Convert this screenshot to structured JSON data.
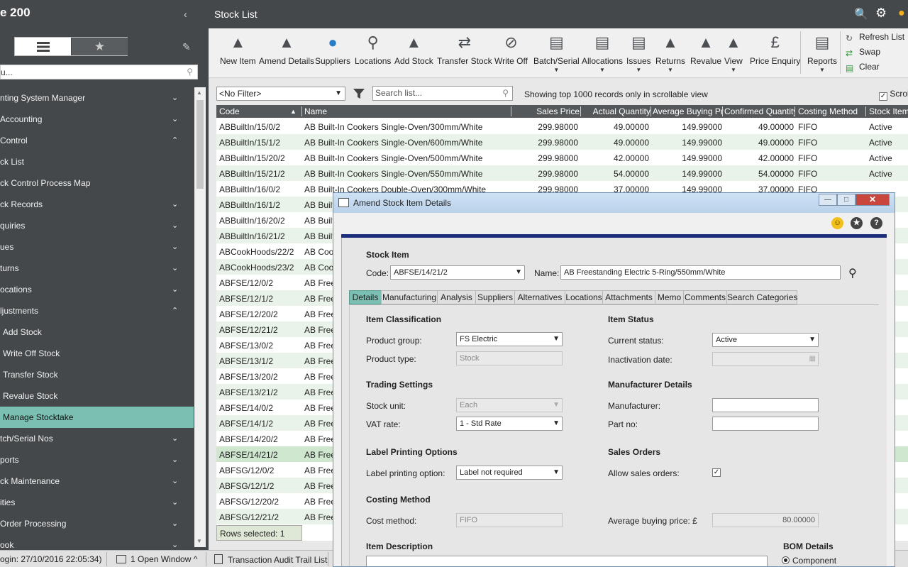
{
  "app": {
    "title": "e 200"
  },
  "sidebar": {
    "search_placeholder": "u...",
    "items": [
      {
        "label": "nting System Manager",
        "chev": "⌄",
        "cls": ""
      },
      {
        "label": "Accounting",
        "chev": "⌄",
        "cls": ""
      },
      {
        "label": "Control",
        "chev": "⌃",
        "cls": ""
      },
      {
        "label": "ck List",
        "chev": "",
        "cls": ""
      },
      {
        "label": "ck Control Process Map",
        "chev": "",
        "cls": ""
      },
      {
        "label": "ck Records",
        "chev": "⌄",
        "cls": ""
      },
      {
        "label": "quiries",
        "chev": "⌄",
        "cls": ""
      },
      {
        "label": "ues",
        "chev": "⌄",
        "cls": ""
      },
      {
        "label": "turns",
        "chev": "⌄",
        "cls": ""
      },
      {
        "label": "ocations",
        "chev": "⌄",
        "cls": ""
      },
      {
        "label": "ljustments",
        "chev": "⌃",
        "cls": ""
      },
      {
        "label": "Add Stock",
        "chev": "",
        "cls": "sub"
      },
      {
        "label": "Write Off Stock",
        "chev": "",
        "cls": "sub"
      },
      {
        "label": "Transfer Stock",
        "chev": "",
        "cls": "sub"
      },
      {
        "label": "Revalue Stock",
        "chev": "",
        "cls": "sub"
      },
      {
        "label": "Manage Stocktake",
        "chev": "",
        "cls": "sub active"
      },
      {
        "label": "tch/Serial Nos",
        "chev": "⌄",
        "cls": ""
      },
      {
        "label": "ports",
        "chev": "⌄",
        "cls": ""
      },
      {
        "label": "ck Maintenance",
        "chev": "⌄",
        "cls": ""
      },
      {
        "label": "ities",
        "chev": "⌄",
        "cls": ""
      },
      {
        "label": "Order Processing",
        "chev": "⌄",
        "cls": ""
      },
      {
        "label": "ook",
        "chev": "⌄",
        "cls": ""
      }
    ]
  },
  "header": {
    "title": "Stock List"
  },
  "toolbar": {
    "buttons": [
      "New Item",
      "Amend Details",
      "Suppliers",
      "Locations",
      "Add Stock",
      "Transfer Stock",
      "Write Off",
      "Batch/Serial",
      "Allocations",
      "Issues",
      "Returns",
      "Revalue",
      "View",
      "Price Enquiry",
      "Reports"
    ],
    "side": [
      "Refresh List",
      "Swap",
      "Clear"
    ]
  },
  "filter": {
    "selected": "<No Filter>",
    "search_placeholder": "Search list...",
    "showing": "Showing top 1000 records only in scrollable view",
    "scroll_label": "Scrol"
  },
  "grid": {
    "columns": [
      "Code",
      "Name",
      "Sales Price",
      "Actual Quantity",
      "Average Buying Pric",
      "Confirmed Quantity I",
      "Costing Method",
      "Stock Item S"
    ],
    "rows": [
      [
        "ABBuiltIn/15/0/2",
        "AB Built-In Cookers Single-Oven/300mm/White",
        "299.98000",
        "49.00000",
        "149.99000",
        "49.00000",
        "FIFO",
        "Active"
      ],
      [
        "ABBuiltIn/15/1/2",
        "AB Built-In Cookers Single-Oven/600mm/White",
        "299.98000",
        "49.00000",
        "149.99000",
        "49.00000",
        "FIFO",
        "Active"
      ],
      [
        "ABBuiltIn/15/20/2",
        "AB Built-In Cookers Single-Oven/500mm/White",
        "299.98000",
        "42.00000",
        "149.99000",
        "42.00000",
        "FIFO",
        "Active"
      ],
      [
        "ABBuiltIn/15/21/2",
        "AB Built-In Cookers Single-Oven/550mm/White",
        "299.98000",
        "54.00000",
        "149.99000",
        "54.00000",
        "FIFO",
        "Active"
      ],
      [
        "ABBuiltIn/16/0/2",
        "AB Built-In Cookers Double-Oven/300mm/White",
        "299.98000",
        "37.00000",
        "149.99000",
        "37.00000",
        "FIFO",
        ""
      ],
      [
        "ABBuiltIn/16/1/2",
        "AB Built",
        "",
        "",
        "",
        "",
        "",
        ""
      ],
      [
        "ABBuiltIn/16/20/2",
        "AB Built",
        "",
        "",
        "",
        "",
        "",
        ""
      ],
      [
        "ABBuiltIn/16/21/2",
        "AB Built",
        "",
        "",
        "",
        "",
        "",
        ""
      ],
      [
        "ABCookHoods/22/2",
        "AB Coo",
        "",
        "",
        "",
        "",
        "",
        ""
      ],
      [
        "ABCookHoods/23/2",
        "AB Coo",
        "",
        "",
        "",
        "",
        "",
        ""
      ],
      [
        "ABFSE/12/0/2",
        "AB Free",
        "",
        "",
        "",
        "",
        "",
        ""
      ],
      [
        "ABFSE/12/1/2",
        "AB Free",
        "",
        "",
        "",
        "",
        "",
        ""
      ],
      [
        "ABFSE/12/20/2",
        "AB Free",
        "",
        "",
        "",
        "",
        "",
        ""
      ],
      [
        "ABFSE/12/21/2",
        "AB Free",
        "",
        "",
        "",
        "",
        "",
        ""
      ],
      [
        "ABFSE/13/0/2",
        "AB Free",
        "",
        "",
        "",
        "",
        "",
        ""
      ],
      [
        "ABFSE/13/1/2",
        "AB Free",
        "",
        "",
        "",
        "",
        "",
        ""
      ],
      [
        "ABFSE/13/20/2",
        "AB Free",
        "",
        "",
        "",
        "",
        "",
        ""
      ],
      [
        "ABFSE/13/21/2",
        "AB Free",
        "",
        "",
        "",
        "",
        "",
        ""
      ],
      [
        "ABFSE/14/0/2",
        "AB Free",
        "",
        "",
        "",
        "",
        "",
        ""
      ],
      [
        "ABFSE/14/1/2",
        "AB Free",
        "",
        "",
        "",
        "",
        "",
        ""
      ],
      [
        "ABFSE/14/20/2",
        "AB Free",
        "",
        "",
        "",
        "",
        "",
        ""
      ],
      [
        "ABFSE/14/21/2",
        "AB Free",
        "",
        "",
        "",
        "",
        "",
        ""
      ],
      [
        "ABFSG/12/0/2",
        "AB Free",
        "",
        "",
        "",
        "",
        "",
        ""
      ],
      [
        "ABFSG/12/1/2",
        "AB Free",
        "",
        "",
        "",
        "",
        "",
        ""
      ],
      [
        "ABFSG/12/20/2",
        "AB Free",
        "",
        "",
        "",
        "",
        "",
        ""
      ],
      [
        "ABFSG/12/21/2",
        "AB Free",
        "",
        "",
        "",
        "",
        "",
        ""
      ]
    ],
    "selected_row": 21,
    "rows_selected": "Rows selected: 1"
  },
  "statusbar": {
    "login": "ogin: 27/10/2016 22:05:34)",
    "open_windows": "1 Open Window ^",
    "audit": "Transaction Audit Trail List"
  },
  "dialog": {
    "title": "Amend Stock Item Details",
    "section_title": "Stock Item",
    "code_label": "Code:",
    "code_value": "ABFSE/14/21/2",
    "name_label": "Name:",
    "name_value": "AB Freestanding Electric 5-Ring/550mm/White",
    "tabs": [
      "Details",
      "Manufacturing",
      "Analysis",
      "Suppliers",
      "Alternatives",
      "Locations",
      "Attachments",
      "Memo",
      "Comments",
      "Search Categories"
    ],
    "item_classification": "Item Classification",
    "product_group_label": "Product group:",
    "product_group": "FS Electric",
    "product_type_label": "Product type:",
    "product_type": "Stock",
    "item_status": "Item Status",
    "current_status_label": "Current status:",
    "current_status": "Active",
    "inactivation_label": "Inactivation date:",
    "trading_settings": "Trading Settings",
    "stock_unit_label": "Stock unit:",
    "stock_unit": "Each",
    "vat_label": "VAT rate:",
    "vat_rate": "1 - Std Rate",
    "manufacturer_details": "Manufacturer Details",
    "manufacturer_label": "Manufacturer:",
    "part_no_label": "Part no:",
    "label_printing": "Label Printing Options",
    "label_option_label": "Label printing option:",
    "label_option": "Label not required",
    "sales_orders": "Sales Orders",
    "allow_sales_label": "Allow sales orders:",
    "costing_method": "Costing Method",
    "cost_method_label": "Cost method:",
    "cost_method": "FIFO",
    "avg_buying_label": "Average buying price: £",
    "avg_buying": "80.00000",
    "item_description": "Item Description",
    "bom_details": "BOM Details",
    "bom_component": "Component"
  },
  "colors": {
    "accent": "#7bbfb2",
    "sidebar_bg": "#45484b",
    "dialog_rule": "#1c2f7c"
  }
}
